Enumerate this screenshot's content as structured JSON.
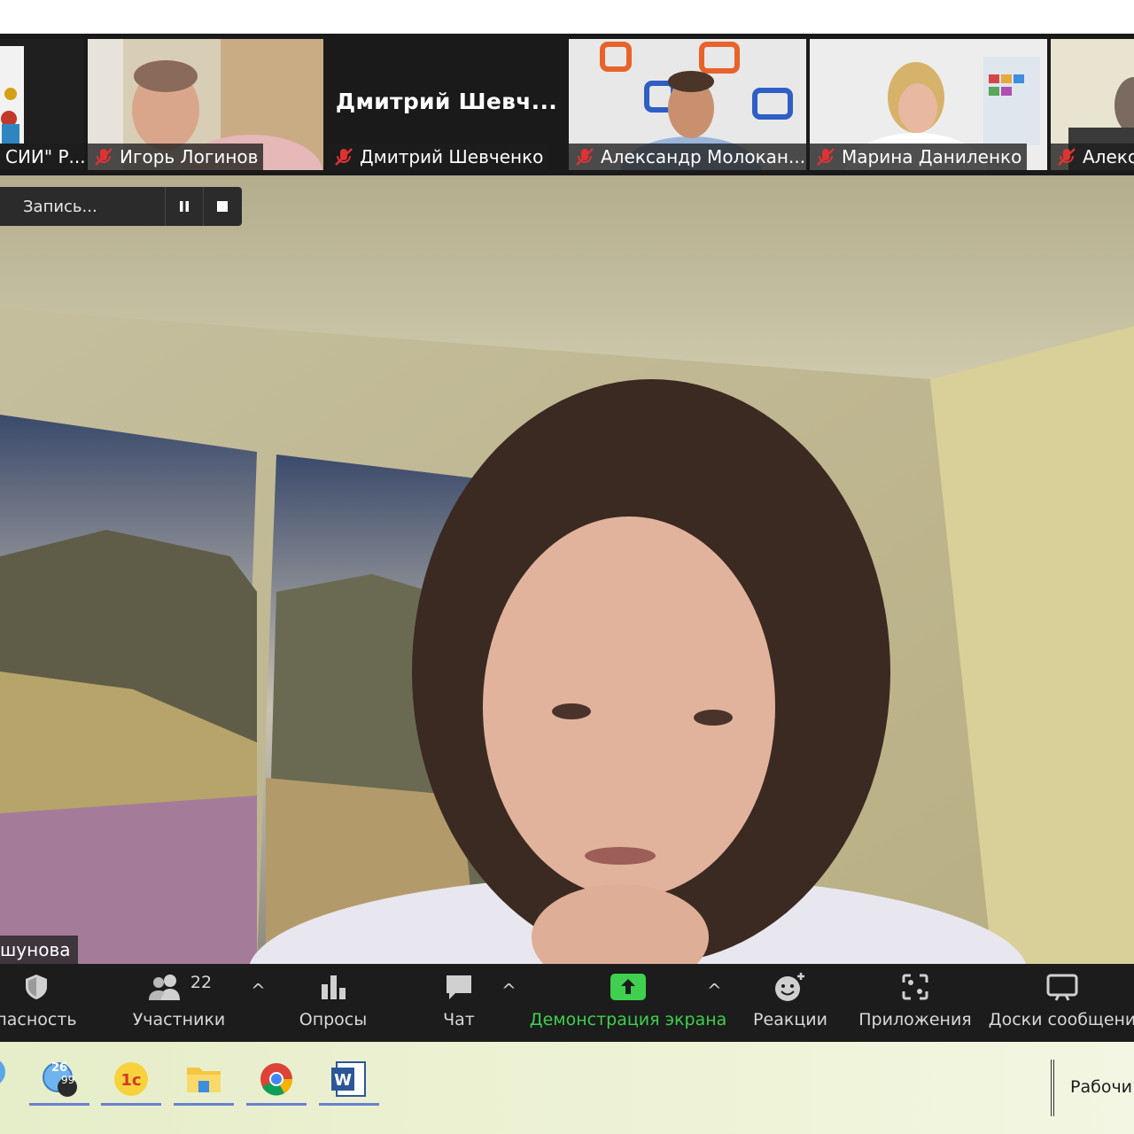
{
  "gallery": {
    "tiles": [
      {
        "name": "СИИ\" Р..."
      },
      {
        "name": "Игорь Логинов"
      },
      {
        "name": "Дмитрий Шевченко",
        "display_name": "Дмитрий  Шевч..."
      },
      {
        "name": "Александр Молокан..."
      },
      {
        "name": "Марина Даниленко"
      },
      {
        "name": "Алекс"
      }
    ]
  },
  "recording": {
    "label": "Запись..."
  },
  "speaker": {
    "name": "шунова"
  },
  "toolbar": {
    "security": "пасность",
    "participants": "Участники",
    "participants_count": "22",
    "polls": "Опросы",
    "chat": "Чат",
    "share_screen": "Демонстрация экрана",
    "reactions": "Реакции",
    "apps": "Приложения",
    "whiteboards": "Доски сообщени"
  },
  "taskbar": {
    "weather_badge": "99",
    "weather_temp": "26",
    "desktop_label": "Рабочи"
  },
  "colors": {
    "toolbar_bg": "#1c1c1c",
    "share_green": "#3ed04e",
    "mute_red": "#e03232"
  }
}
